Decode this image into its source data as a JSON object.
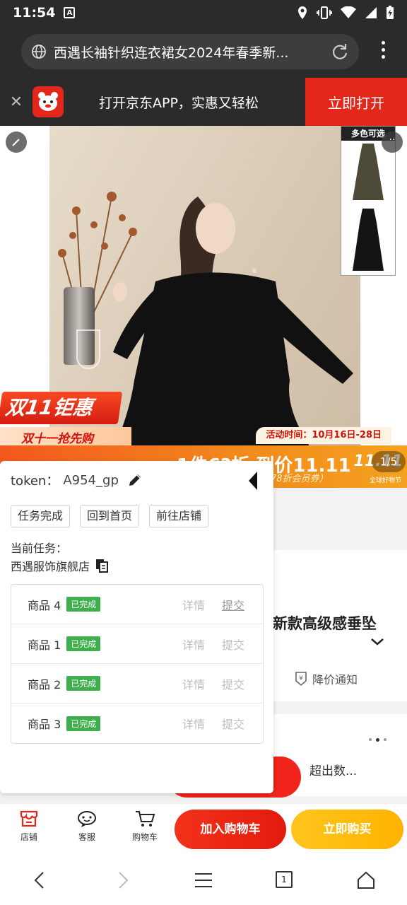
{
  "status_bar": {
    "time": "11:54",
    "notif_badge": "A"
  },
  "browser": {
    "tab_title": "西遇长袖针织连衣裙女2024年春季新..."
  },
  "jd_banner": {
    "message": "打开京东APP，实惠又轻松",
    "open_button": "立即打开"
  },
  "hero": {
    "swatch_header": "多色可选",
    "promo_title": "双11钜惠",
    "promo_sub": "双十一抢先购",
    "activity_time": "活动时间：10月16日-28日",
    "price_text": "1件6?折 到价11.11",
    "member_text": "（78折会员券）",
    "double11": "11.11",
    "double11_sub": "全球好物节",
    "page_indicator": "1/5"
  },
  "under_page": {
    "product_name_fragment": "新款高级感垂坠",
    "price_notify": "降价通知",
    "exceed_text": "超出数..."
  },
  "panel": {
    "token_label": "token：",
    "token_value": "A954_gp",
    "buttons": [
      "任务完成",
      "回到首页",
      "前往店铺"
    ],
    "current_task_label": "当前任务：",
    "current_task_shop": "西遇服饰旗舰店",
    "rows": [
      {
        "name": "商品 4",
        "status": "已完成",
        "detail": "详情",
        "submit": "提交",
        "submit_underlined": true
      },
      {
        "name": "商品 1",
        "status": "已完成",
        "detail": "详情",
        "submit": "提交",
        "submit_underlined": false
      },
      {
        "name": "商品 2",
        "status": "已完成",
        "detail": "详情",
        "submit": "提交",
        "submit_underlined": false
      },
      {
        "name": "商品 3",
        "status": "已完成",
        "detail": "详情",
        "submit": "提交",
        "submit_underlined": false
      }
    ]
  },
  "action_bar": {
    "store": "店铺",
    "service": "客服",
    "cart": "购物车",
    "add_to_cart": "加入购物车",
    "buy_now": "立即购买"
  },
  "nav": {
    "tabs_count": "1"
  },
  "colors": {
    "jd_red": "#e4271b",
    "buy_yellow": "#ffbb10",
    "done_green": "#3fae4d"
  }
}
